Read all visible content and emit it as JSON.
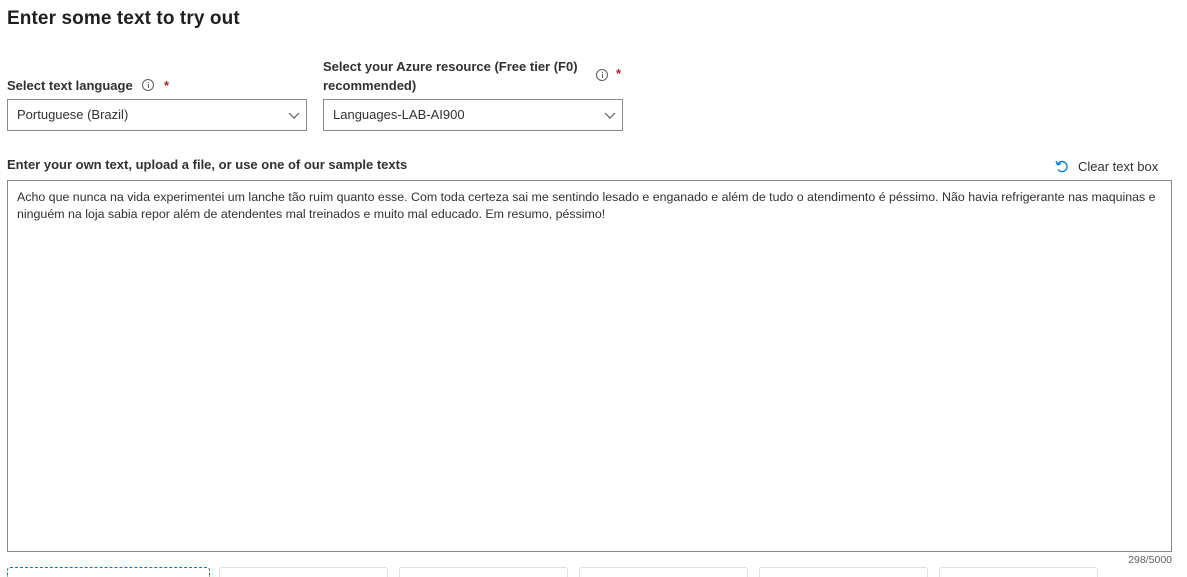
{
  "page": {
    "title": "Enter some text to try out"
  },
  "language_field": {
    "label": "Select text language",
    "required_mark": "*",
    "selected": "Portuguese (Brazil)"
  },
  "resource_field": {
    "label_line1": "Select your Azure resource (Free tier (F0)",
    "label_line2": "recommended)",
    "required_mark": "*",
    "selected": "Languages-LAB-AI900"
  },
  "text_input": {
    "label": "Enter your own text, upload a file, or use one of our sample texts",
    "clear_label": "Clear text box",
    "value": "Acho que nunca na vida experimentei um lanche tão ruim quanto esse. Com toda certeza sai me sentindo lesado e enganado e além de tudo o atendimento é péssimo. Não havia refrigerante nas maquinas e ninguém na loja sabia repor além de atendentes mal treinados e muito mal educado. Em resumo, péssimo!",
    "counter": "298/5000"
  },
  "icons": {
    "info": "info-icon",
    "chevron": "chevron-down-icon",
    "undo": "undo-icon"
  },
  "colors": {
    "accent": "#0078d4",
    "required": "#a4262c",
    "border": "#8a8886"
  }
}
